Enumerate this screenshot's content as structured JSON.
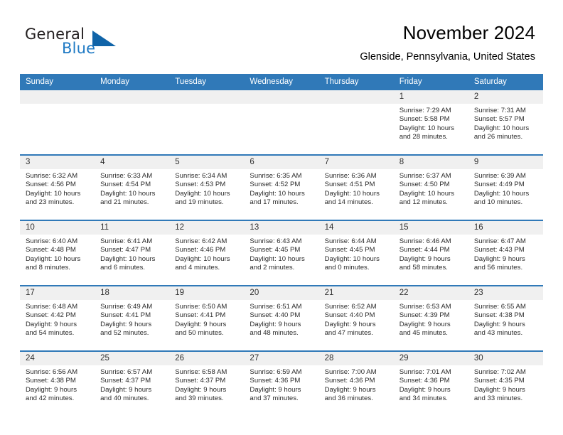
{
  "brand": {
    "line1": "General",
    "line2": "Blue",
    "triangle_color": "#1064a8",
    "blue_text_color": "#1f7ac4"
  },
  "header": {
    "title": "November 2024",
    "subtitle": "Glenside, Pennsylvania, United States"
  },
  "theme": {
    "header_blue": "#3079b8",
    "daynum_band": "#f0f0f0",
    "divider_blue": "#3079b8"
  },
  "calendar": {
    "weekday_headers": [
      "Sunday",
      "Monday",
      "Tuesday",
      "Wednesday",
      "Thursday",
      "Friday",
      "Saturday"
    ],
    "weeks": [
      [
        {
          "day": "",
          "sunrise": "",
          "sunset": "",
          "daylight1": "",
          "daylight2": ""
        },
        {
          "day": "",
          "sunrise": "",
          "sunset": "",
          "daylight1": "",
          "daylight2": ""
        },
        {
          "day": "",
          "sunrise": "",
          "sunset": "",
          "daylight1": "",
          "daylight2": ""
        },
        {
          "day": "",
          "sunrise": "",
          "sunset": "",
          "daylight1": "",
          "daylight2": ""
        },
        {
          "day": "",
          "sunrise": "",
          "sunset": "",
          "daylight1": "",
          "daylight2": ""
        },
        {
          "day": "1",
          "sunrise": "Sunrise: 7:29 AM",
          "sunset": "Sunset: 5:58 PM",
          "daylight1": "Daylight: 10 hours",
          "daylight2": "and 28 minutes."
        },
        {
          "day": "2",
          "sunrise": "Sunrise: 7:31 AM",
          "sunset": "Sunset: 5:57 PM",
          "daylight1": "Daylight: 10 hours",
          "daylight2": "and 26 minutes."
        }
      ],
      [
        {
          "day": "3",
          "sunrise": "Sunrise: 6:32 AM",
          "sunset": "Sunset: 4:56 PM",
          "daylight1": "Daylight: 10 hours",
          "daylight2": "and 23 minutes."
        },
        {
          "day": "4",
          "sunrise": "Sunrise: 6:33 AM",
          "sunset": "Sunset: 4:54 PM",
          "daylight1": "Daylight: 10 hours",
          "daylight2": "and 21 minutes."
        },
        {
          "day": "5",
          "sunrise": "Sunrise: 6:34 AM",
          "sunset": "Sunset: 4:53 PM",
          "daylight1": "Daylight: 10 hours",
          "daylight2": "and 19 minutes."
        },
        {
          "day": "6",
          "sunrise": "Sunrise: 6:35 AM",
          "sunset": "Sunset: 4:52 PM",
          "daylight1": "Daylight: 10 hours",
          "daylight2": "and 17 minutes."
        },
        {
          "day": "7",
          "sunrise": "Sunrise: 6:36 AM",
          "sunset": "Sunset: 4:51 PM",
          "daylight1": "Daylight: 10 hours",
          "daylight2": "and 14 minutes."
        },
        {
          "day": "8",
          "sunrise": "Sunrise: 6:37 AM",
          "sunset": "Sunset: 4:50 PM",
          "daylight1": "Daylight: 10 hours",
          "daylight2": "and 12 minutes."
        },
        {
          "day": "9",
          "sunrise": "Sunrise: 6:39 AM",
          "sunset": "Sunset: 4:49 PM",
          "daylight1": "Daylight: 10 hours",
          "daylight2": "and 10 minutes."
        }
      ],
      [
        {
          "day": "10",
          "sunrise": "Sunrise: 6:40 AM",
          "sunset": "Sunset: 4:48 PM",
          "daylight1": "Daylight: 10 hours",
          "daylight2": "and 8 minutes."
        },
        {
          "day": "11",
          "sunrise": "Sunrise: 6:41 AM",
          "sunset": "Sunset: 4:47 PM",
          "daylight1": "Daylight: 10 hours",
          "daylight2": "and 6 minutes."
        },
        {
          "day": "12",
          "sunrise": "Sunrise: 6:42 AM",
          "sunset": "Sunset: 4:46 PM",
          "daylight1": "Daylight: 10 hours",
          "daylight2": "and 4 minutes."
        },
        {
          "day": "13",
          "sunrise": "Sunrise: 6:43 AM",
          "sunset": "Sunset: 4:45 PM",
          "daylight1": "Daylight: 10 hours",
          "daylight2": "and 2 minutes."
        },
        {
          "day": "14",
          "sunrise": "Sunrise: 6:44 AM",
          "sunset": "Sunset: 4:45 PM",
          "daylight1": "Daylight: 10 hours",
          "daylight2": "and 0 minutes."
        },
        {
          "day": "15",
          "sunrise": "Sunrise: 6:46 AM",
          "sunset": "Sunset: 4:44 PM",
          "daylight1": "Daylight: 9 hours",
          "daylight2": "and 58 minutes."
        },
        {
          "day": "16",
          "sunrise": "Sunrise: 6:47 AM",
          "sunset": "Sunset: 4:43 PM",
          "daylight1": "Daylight: 9 hours",
          "daylight2": "and 56 minutes."
        }
      ],
      [
        {
          "day": "17",
          "sunrise": "Sunrise: 6:48 AM",
          "sunset": "Sunset: 4:42 PM",
          "daylight1": "Daylight: 9 hours",
          "daylight2": "and 54 minutes."
        },
        {
          "day": "18",
          "sunrise": "Sunrise: 6:49 AM",
          "sunset": "Sunset: 4:41 PM",
          "daylight1": "Daylight: 9 hours",
          "daylight2": "and 52 minutes."
        },
        {
          "day": "19",
          "sunrise": "Sunrise: 6:50 AM",
          "sunset": "Sunset: 4:41 PM",
          "daylight1": "Daylight: 9 hours",
          "daylight2": "and 50 minutes."
        },
        {
          "day": "20",
          "sunrise": "Sunrise: 6:51 AM",
          "sunset": "Sunset: 4:40 PM",
          "daylight1": "Daylight: 9 hours",
          "daylight2": "and 48 minutes."
        },
        {
          "day": "21",
          "sunrise": "Sunrise: 6:52 AM",
          "sunset": "Sunset: 4:40 PM",
          "daylight1": "Daylight: 9 hours",
          "daylight2": "and 47 minutes."
        },
        {
          "day": "22",
          "sunrise": "Sunrise: 6:53 AM",
          "sunset": "Sunset: 4:39 PM",
          "daylight1": "Daylight: 9 hours",
          "daylight2": "and 45 minutes."
        },
        {
          "day": "23",
          "sunrise": "Sunrise: 6:55 AM",
          "sunset": "Sunset: 4:38 PM",
          "daylight1": "Daylight: 9 hours",
          "daylight2": "and 43 minutes."
        }
      ],
      [
        {
          "day": "24",
          "sunrise": "Sunrise: 6:56 AM",
          "sunset": "Sunset: 4:38 PM",
          "daylight1": "Daylight: 9 hours",
          "daylight2": "and 42 minutes."
        },
        {
          "day": "25",
          "sunrise": "Sunrise: 6:57 AM",
          "sunset": "Sunset: 4:37 PM",
          "daylight1": "Daylight: 9 hours",
          "daylight2": "and 40 minutes."
        },
        {
          "day": "26",
          "sunrise": "Sunrise: 6:58 AM",
          "sunset": "Sunset: 4:37 PM",
          "daylight1": "Daylight: 9 hours",
          "daylight2": "and 39 minutes."
        },
        {
          "day": "27",
          "sunrise": "Sunrise: 6:59 AM",
          "sunset": "Sunset: 4:36 PM",
          "daylight1": "Daylight: 9 hours",
          "daylight2": "and 37 minutes."
        },
        {
          "day": "28",
          "sunrise": "Sunrise: 7:00 AM",
          "sunset": "Sunset: 4:36 PM",
          "daylight1": "Daylight: 9 hours",
          "daylight2": "and 36 minutes."
        },
        {
          "day": "29",
          "sunrise": "Sunrise: 7:01 AM",
          "sunset": "Sunset: 4:36 PM",
          "daylight1": "Daylight: 9 hours",
          "daylight2": "and 34 minutes."
        },
        {
          "day": "30",
          "sunrise": "Sunrise: 7:02 AM",
          "sunset": "Sunset: 4:35 PM",
          "daylight1": "Daylight: 9 hours",
          "daylight2": "and 33 minutes."
        }
      ]
    ]
  }
}
